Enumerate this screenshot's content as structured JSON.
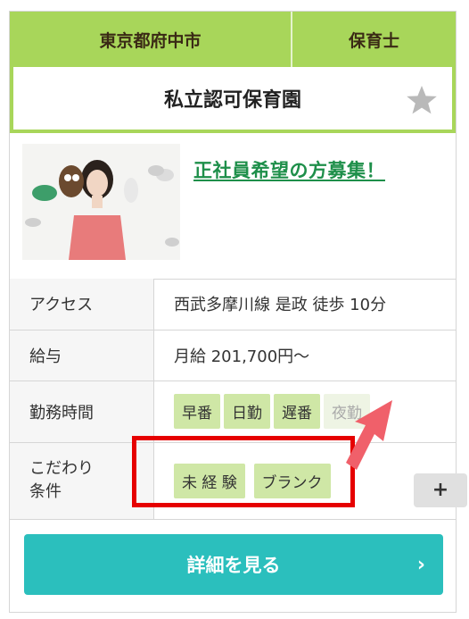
{
  "header": {
    "location": "東京都府中市",
    "job_type": "保育士"
  },
  "title": "私立認可保育園",
  "intro": {
    "headline": "正社員希望の方募集！"
  },
  "info": {
    "access_label": "アクセス",
    "access_value": "西武多摩川線 是政 徒歩 10分",
    "salary_label": "給与",
    "salary_value": "月給 201,700円～",
    "hours_label": "勤務時間",
    "hours_tags": [
      {
        "label": "早番",
        "active": true
      },
      {
        "label": "日勤",
        "active": true
      },
      {
        "label": "遅番",
        "active": true
      },
      {
        "label": "夜勤",
        "active": false
      }
    ],
    "features_label_line1": "こだわり",
    "features_label_line2": "条件",
    "feature_tags": [
      "未 経 験",
      "ブランク"
    ],
    "more_button": "+"
  },
  "detail_button": "詳細を見る",
  "colors": {
    "header_green": "#a8d65a",
    "tag_green": "#cfe7a6",
    "button_teal": "#2bbfbd",
    "highlight_red": "#e60000",
    "arrow_pink": "#f0606a"
  }
}
